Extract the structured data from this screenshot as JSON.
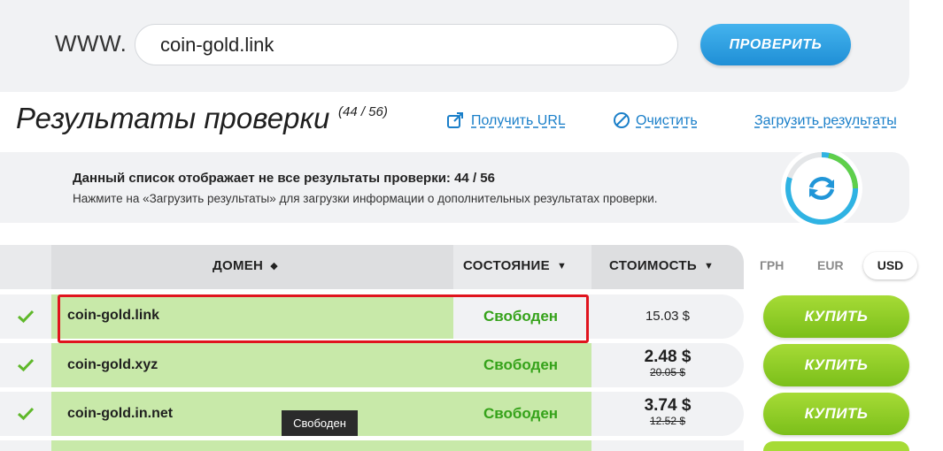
{
  "search": {
    "prefix": "WWW.",
    "value": "coin-gold.link",
    "button_label": "ПРОВЕРИТЬ"
  },
  "results": {
    "title": "Результаты проверки",
    "count": "(44 / 56)",
    "get_url_label": "Получить URL",
    "clear_label": "Очистить",
    "load_label": "Загрузить результаты"
  },
  "info": {
    "bold_text": "Данный список отображает не все результаты проверки: 44 / 56",
    "text": "Нажмите на «Загрузить результаты» для загрузки информации о дополнительных результатах проверки."
  },
  "table": {
    "headers": {
      "domain": "ДОМЕН",
      "status": "СОСТОЯНИЕ",
      "cost": "СТОИМОСТЬ"
    },
    "currencies": [
      "ГРН",
      "EUR",
      "USD"
    ],
    "active_currency": "USD",
    "rows": [
      {
        "domain": "coin-gold.link",
        "status": "Свободен",
        "price": "15.03 $",
        "old_price": "",
        "buy_label": "КУПИТЬ"
      },
      {
        "domain": "coin-gold.xyz",
        "status": "Свободен",
        "price": "2.48 $",
        "old_price": "20.05 $",
        "buy_label": "КУПИТЬ"
      },
      {
        "domain": "coin-gold.in.net",
        "status": "Свободен",
        "price": "3.74 $",
        "old_price": "12.52 $",
        "buy_label": "КУПИТЬ"
      }
    ]
  },
  "tooltip": "Свободен",
  "colors": {
    "accent_blue": "#1f8fd6",
    "buy_green": "#7bbf1a",
    "status_green": "#35a21a",
    "highlight_red": "#e0141e"
  }
}
